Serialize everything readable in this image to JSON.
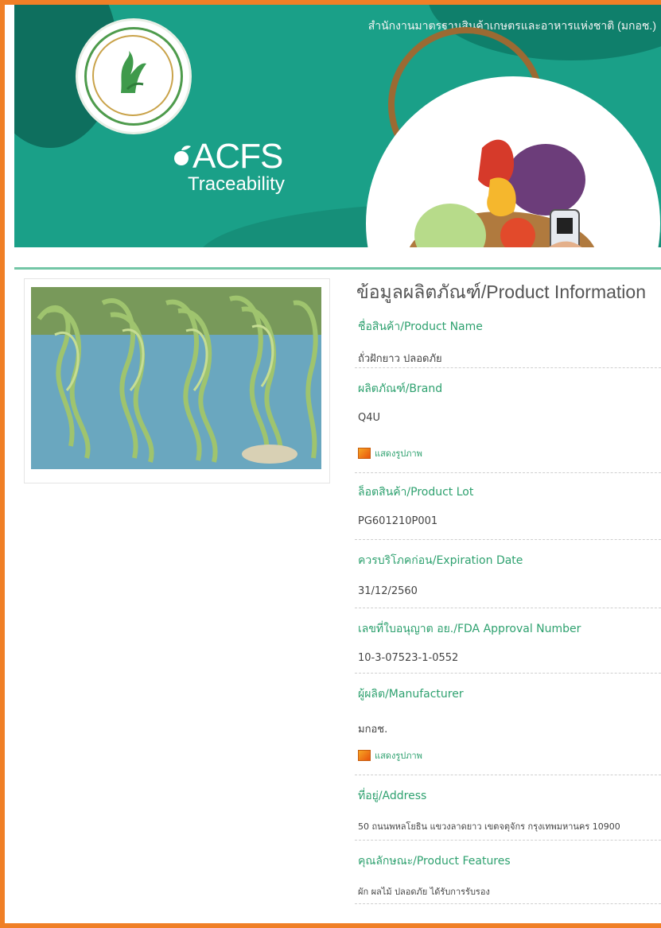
{
  "banner": {
    "agency_text": "สำนักงานมาตรฐานสินค้าเกษตรและอาหารแห่งชาติ (มกอช.)",
    "brand_name": "ACFS",
    "brand_sub": "Traceability"
  },
  "product": {
    "section_title": "ข้อมูลผลิตภัณฑ์/Product Information",
    "fields": [
      {
        "label": "ชื่อสินค้า/Product Name",
        "value": "ถั่วฝักยาว ปลอดภัย"
      },
      {
        "label": "ผลิตภัณฑ์/Brand",
        "value": "Q4U"
      },
      {
        "label": "ล็อตสินค้า/Product Lot",
        "value": "PG601210P001"
      },
      {
        "label": "ควรบริโภคก่อน/Expiration Date",
        "value": "31/12/2560"
      },
      {
        "label": "เลขที่ใบอนุญาต อย./FDA Approval Number",
        "value": "10-3-07523-1-0552"
      },
      {
        "label": "ผู้ผลิต/Manufacturer",
        "value": "มกอช."
      },
      {
        "label": "ที่อยู่/Address",
        "value": "50 ถนนพหลโยธิน แขวงลาดยาว เขตจตุจักร กรุงเทพมหานคร 10900"
      },
      {
        "label": "คุณลักษณะ/Product Features",
        "value": "ผัก ผลไม้ ปลอดภัย ได้รับการรับรอง"
      }
    ],
    "image_links": [
      "แสดงรูปภาพ",
      "แสดงรูปภาพ"
    ]
  },
  "icons": {
    "logo": "acfs-seal-icon",
    "image_link": "image-icon"
  },
  "colors": {
    "frame": "#f07f26",
    "banner": "#1aa088",
    "accent_text": "#2ea16f"
  }
}
